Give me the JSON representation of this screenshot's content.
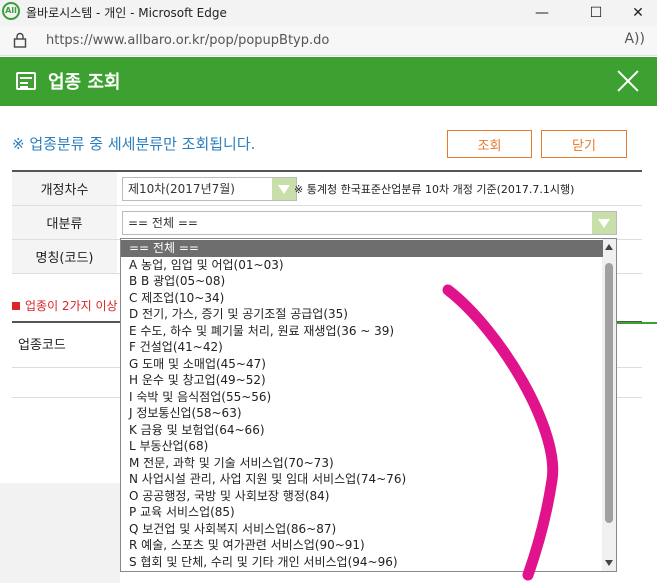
{
  "window": {
    "title": "올바로시스템 - 개인 - Microsoft Edge",
    "app_icon_text": "All",
    "minimize": "—",
    "maximize": "☐",
    "close": "✕"
  },
  "address_bar": {
    "url": "https://www.allbaro.or.kr/pop/popupBtyp.do",
    "reader_icon": "A))"
  },
  "header": {
    "title": "업종 조회",
    "bg_color": "#3ca130"
  },
  "notice": "※ 업종분류 중 세세분류만 조회됩니다.",
  "buttons": {
    "search": "조회",
    "close": "닫기"
  },
  "form": {
    "revision_label": "개정차수",
    "revision_value": "제10차(2017년7월)",
    "revision_hint": "※ 통계청 한국표준산업분류 10차 개정 기준(2017.7.1시행)",
    "major_label": "대분류",
    "major_value": "== 전체 ==",
    "name_label": "명칭(코드)"
  },
  "warning": "업종이 2가지 이상",
  "result_header": "업종코드",
  "dropdown": {
    "options": [
      "== 전체 ==",
      "A 농업, 임업 및 어업(01~03)",
      "B B 광업(05~08)",
      "C 제조업(10~34)",
      "D 전기, 가스, 증기 및 공기조절 공급업(35)",
      "E 수도, 하수 및 폐기물 처리, 원료 재생업(36 ~ 39)",
      "F 건설업(41~42)",
      "G 도매 및 소매업(45~47)",
      "H 운수 및 창고업(49~52)",
      "I 숙박 및 음식점업(55~56)",
      "J 정보통신업(58~63)",
      "K 금융 및 보험업(64~66)",
      "L 부동산업(68)",
      "M 전문, 과학 및 기술 서비스업(70~73)",
      "N 사업시설 관리, 사업 지원 및 임대 서비스업(74~76)",
      "O 공공행정, 국방 및 사회보장 행정(84)",
      "P 교육 서비스업(85)",
      "Q 보건업 및 사회복지 서비스업(86~87)",
      "R 예술, 스포츠 및 여가관련 서비스업(90~91)",
      "S 협회 및 단체, 수리 및 기타 개인 서비스업(94~96)"
    ],
    "selected_index": 0
  },
  "annotation_color": "#e0138c"
}
